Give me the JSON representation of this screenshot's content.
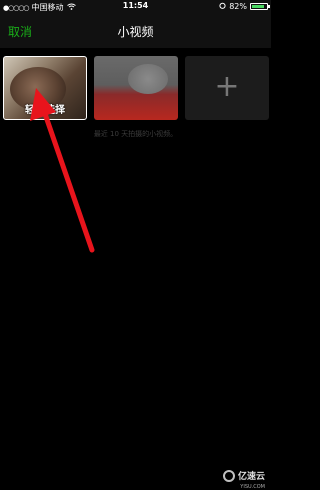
{
  "status_bar": {
    "carrier": "中国移动",
    "time": "11:54",
    "battery": "82%"
  },
  "navbar": {
    "cancel_label": "取消",
    "title": "小视频"
  },
  "thumbnails": [
    {
      "overlay_label": "轻触选择"
    }
  ],
  "hint": "最近 10 天拍摄的小视频。",
  "watermark": {
    "text": "亿速云",
    "sub": "YISU.COM"
  },
  "colors": {
    "accent_green": "#1aad19",
    "arrow_red": "#e8141c"
  }
}
